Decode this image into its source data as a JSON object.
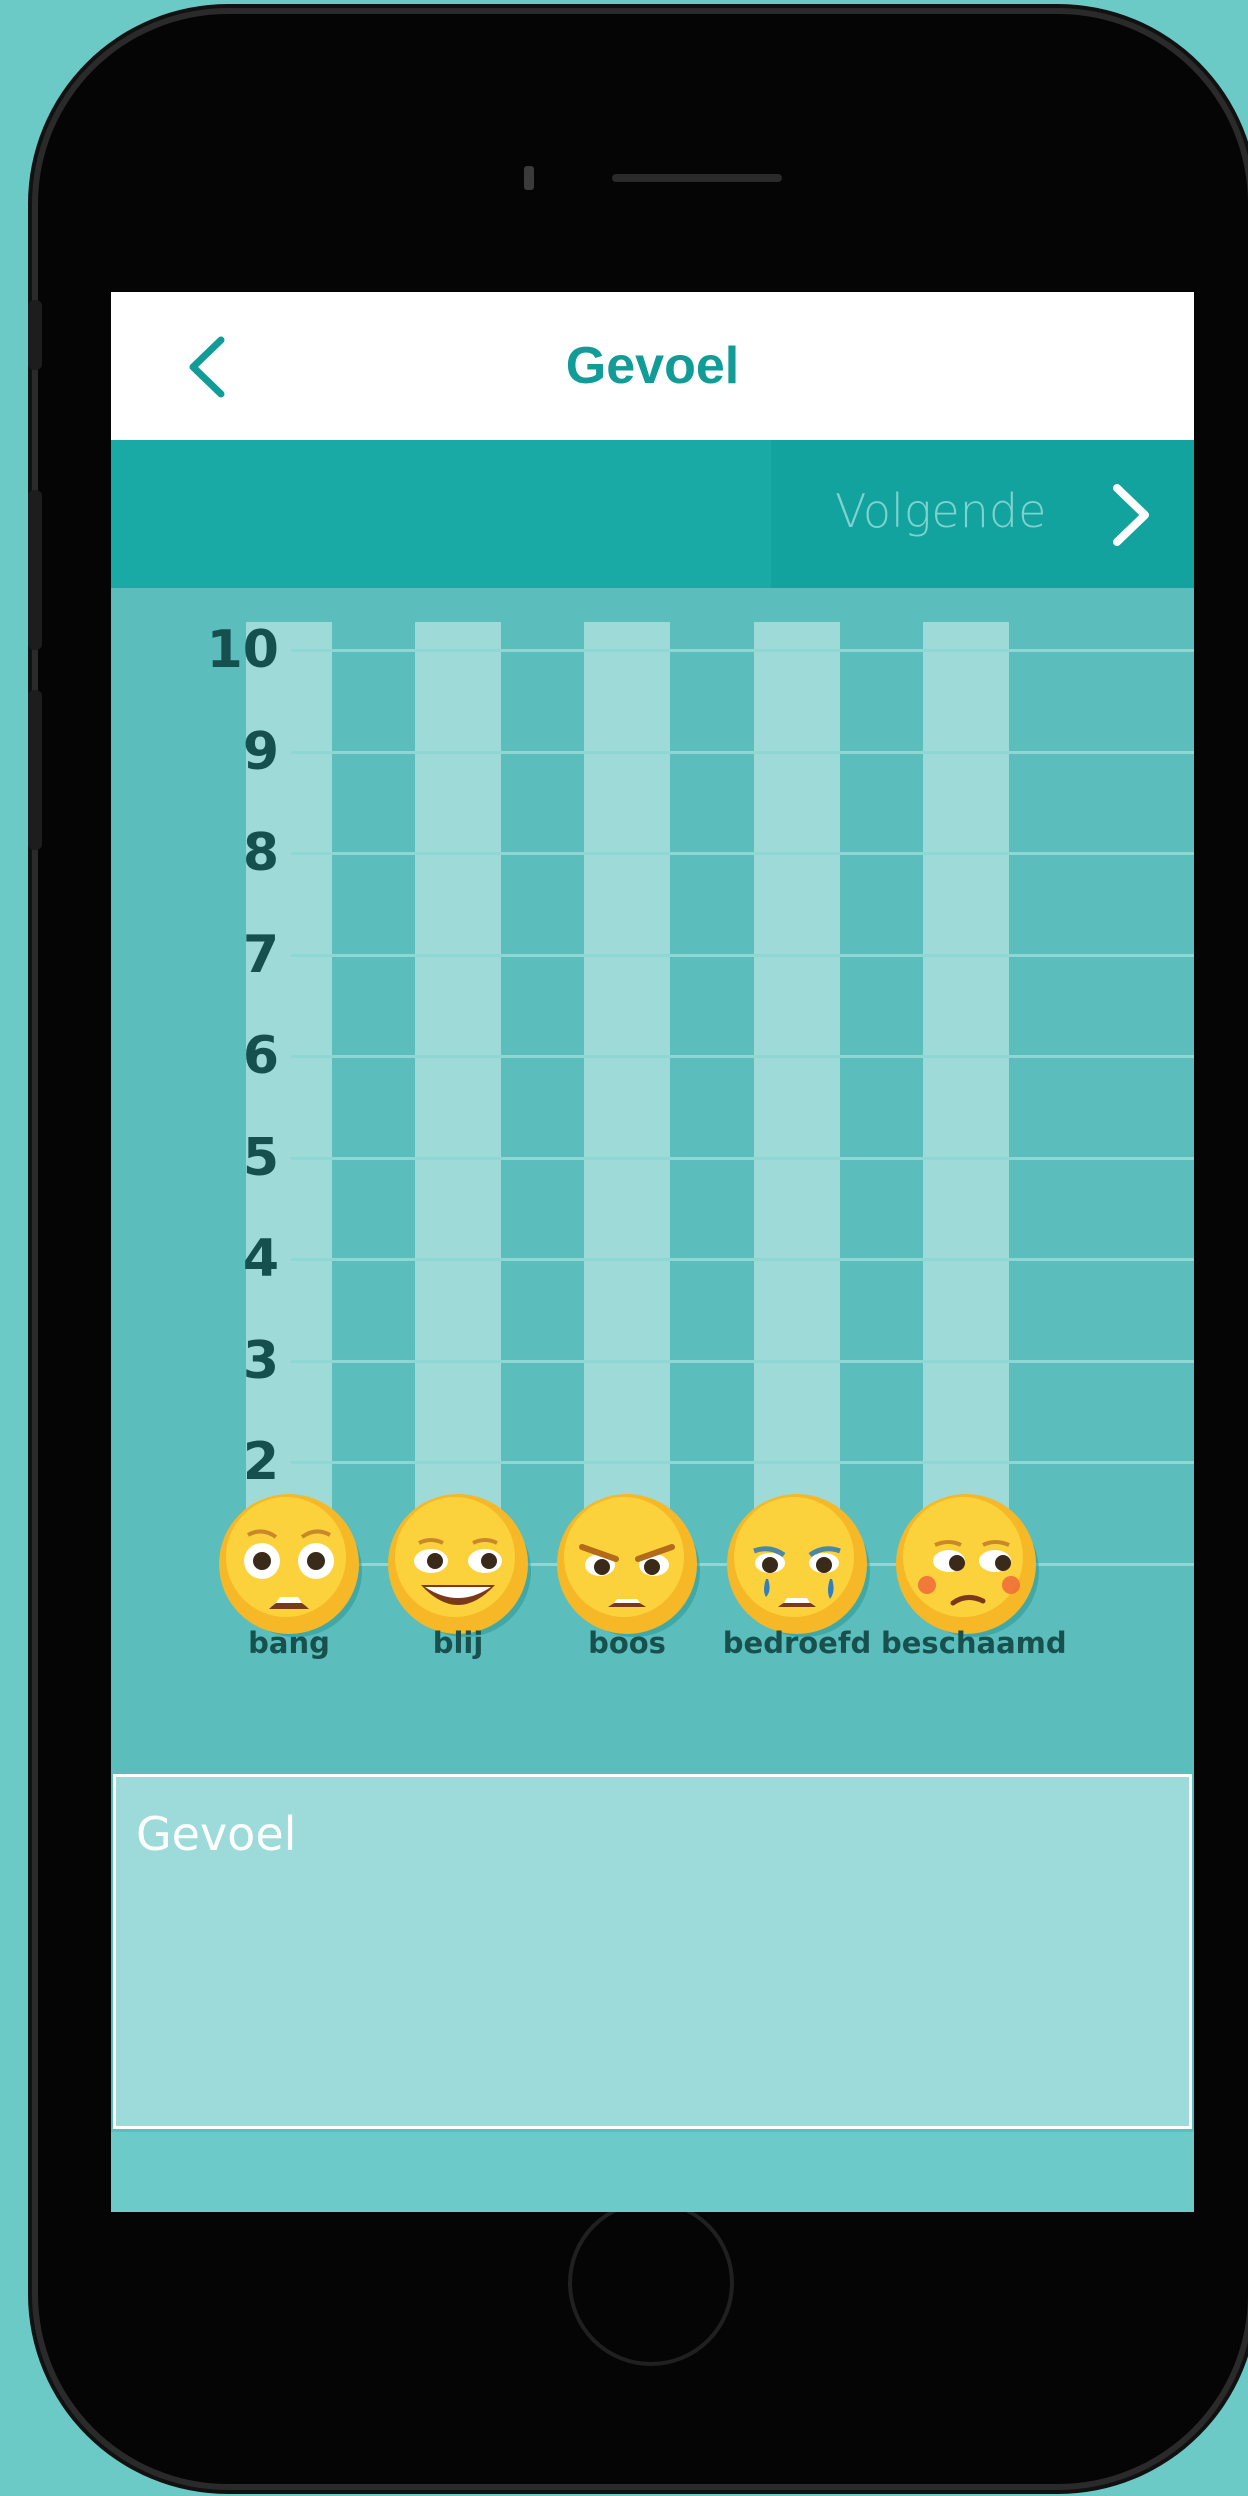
{
  "nav": {
    "title": "Gevoel",
    "back_icon": "chevron-left-icon"
  },
  "toolbar": {
    "next_label": "Volgende",
    "next_icon": "chevron-right-icon"
  },
  "chart": {
    "y_ticks": [
      "10",
      "9",
      "8",
      "7",
      "6",
      "5",
      "4",
      "3",
      "2",
      "1"
    ],
    "emotions": [
      {
        "label": "bang",
        "value": 1,
        "icon": "scared-face-icon"
      },
      {
        "label": "blij",
        "value": 1,
        "icon": "happy-face-icon"
      },
      {
        "label": "boos",
        "value": 1,
        "icon": "angry-face-icon"
      },
      {
        "label": "bedroefd",
        "value": 1,
        "icon": "crying-face-icon"
      },
      {
        "label": "beschaamd",
        "value": 1,
        "icon": "ashamed-face-icon"
      }
    ]
  },
  "notes": {
    "label": "Gevoel"
  },
  "colors": {
    "accent": "#119c98",
    "background": "#5bbebd",
    "toolbar": "#1aaaa6",
    "column": "#9ddad8",
    "emoji": "#f9c52b"
  }
}
